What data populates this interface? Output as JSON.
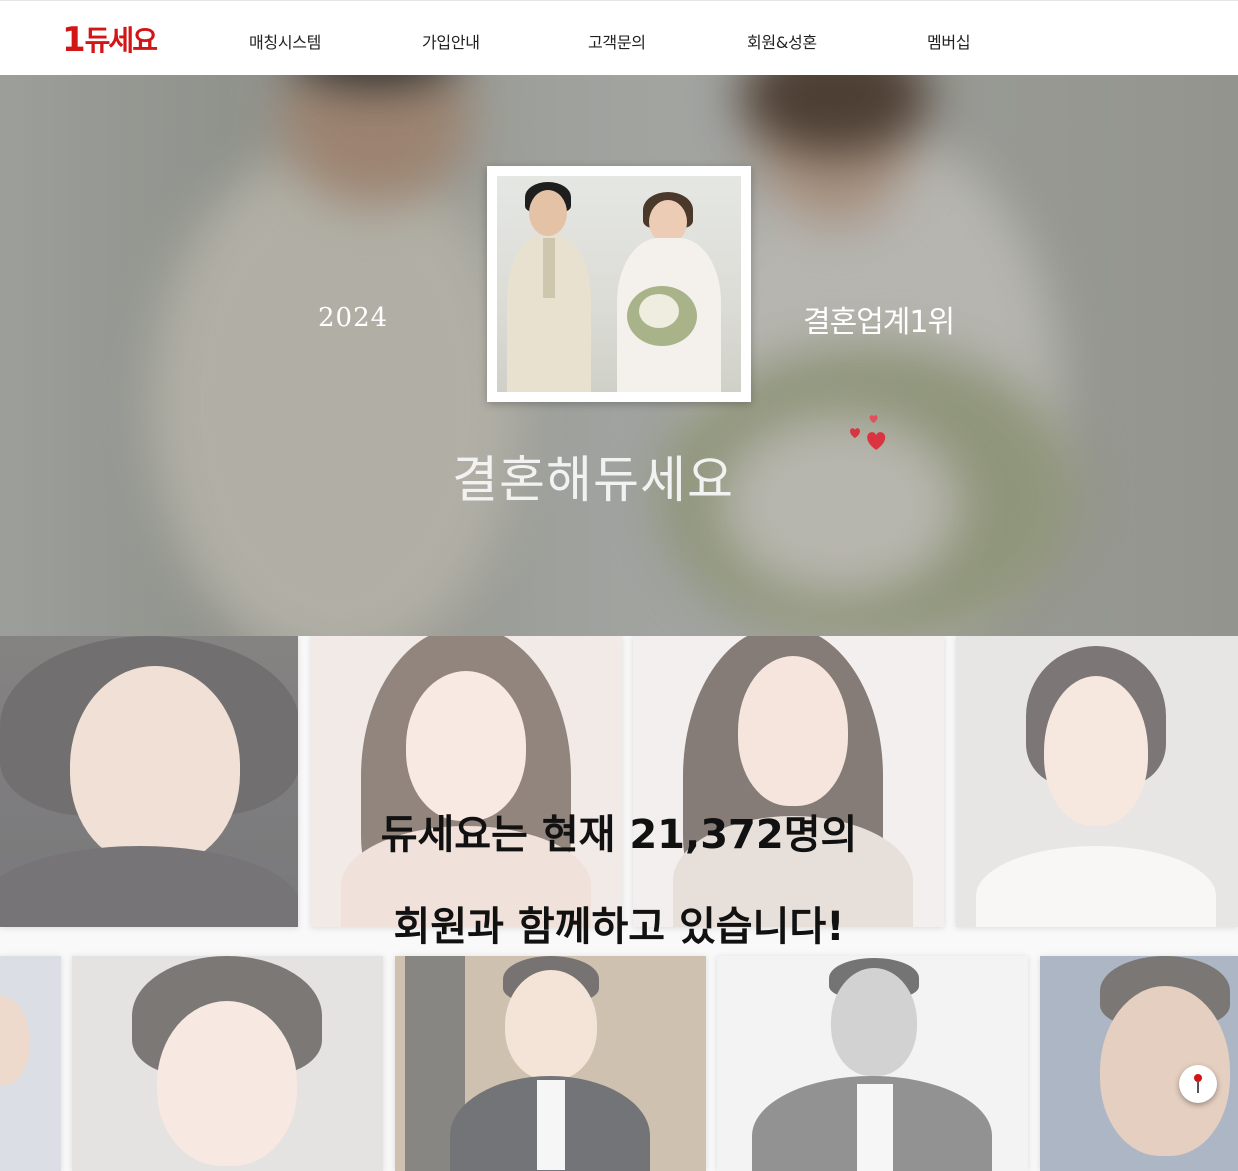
{
  "header": {
    "logo_number": "1",
    "logo_text": "듀세요",
    "nav": [
      "매칭시스템",
      "가입안내",
      "고객문의",
      "회원&성혼",
      "멤버십"
    ]
  },
  "hero": {
    "year": "2024",
    "rank": "결혼업계1위",
    "title": "결혼해듀세요"
  },
  "members": {
    "line1": "듀세요는 현재 21,372명의",
    "line2": "회원과 함께하고 있습니다!"
  },
  "colors": {
    "brand_red": "#d21616",
    "heart": "#d9343f"
  },
  "icons": {
    "scroll_top": "arrow-up-icon"
  }
}
